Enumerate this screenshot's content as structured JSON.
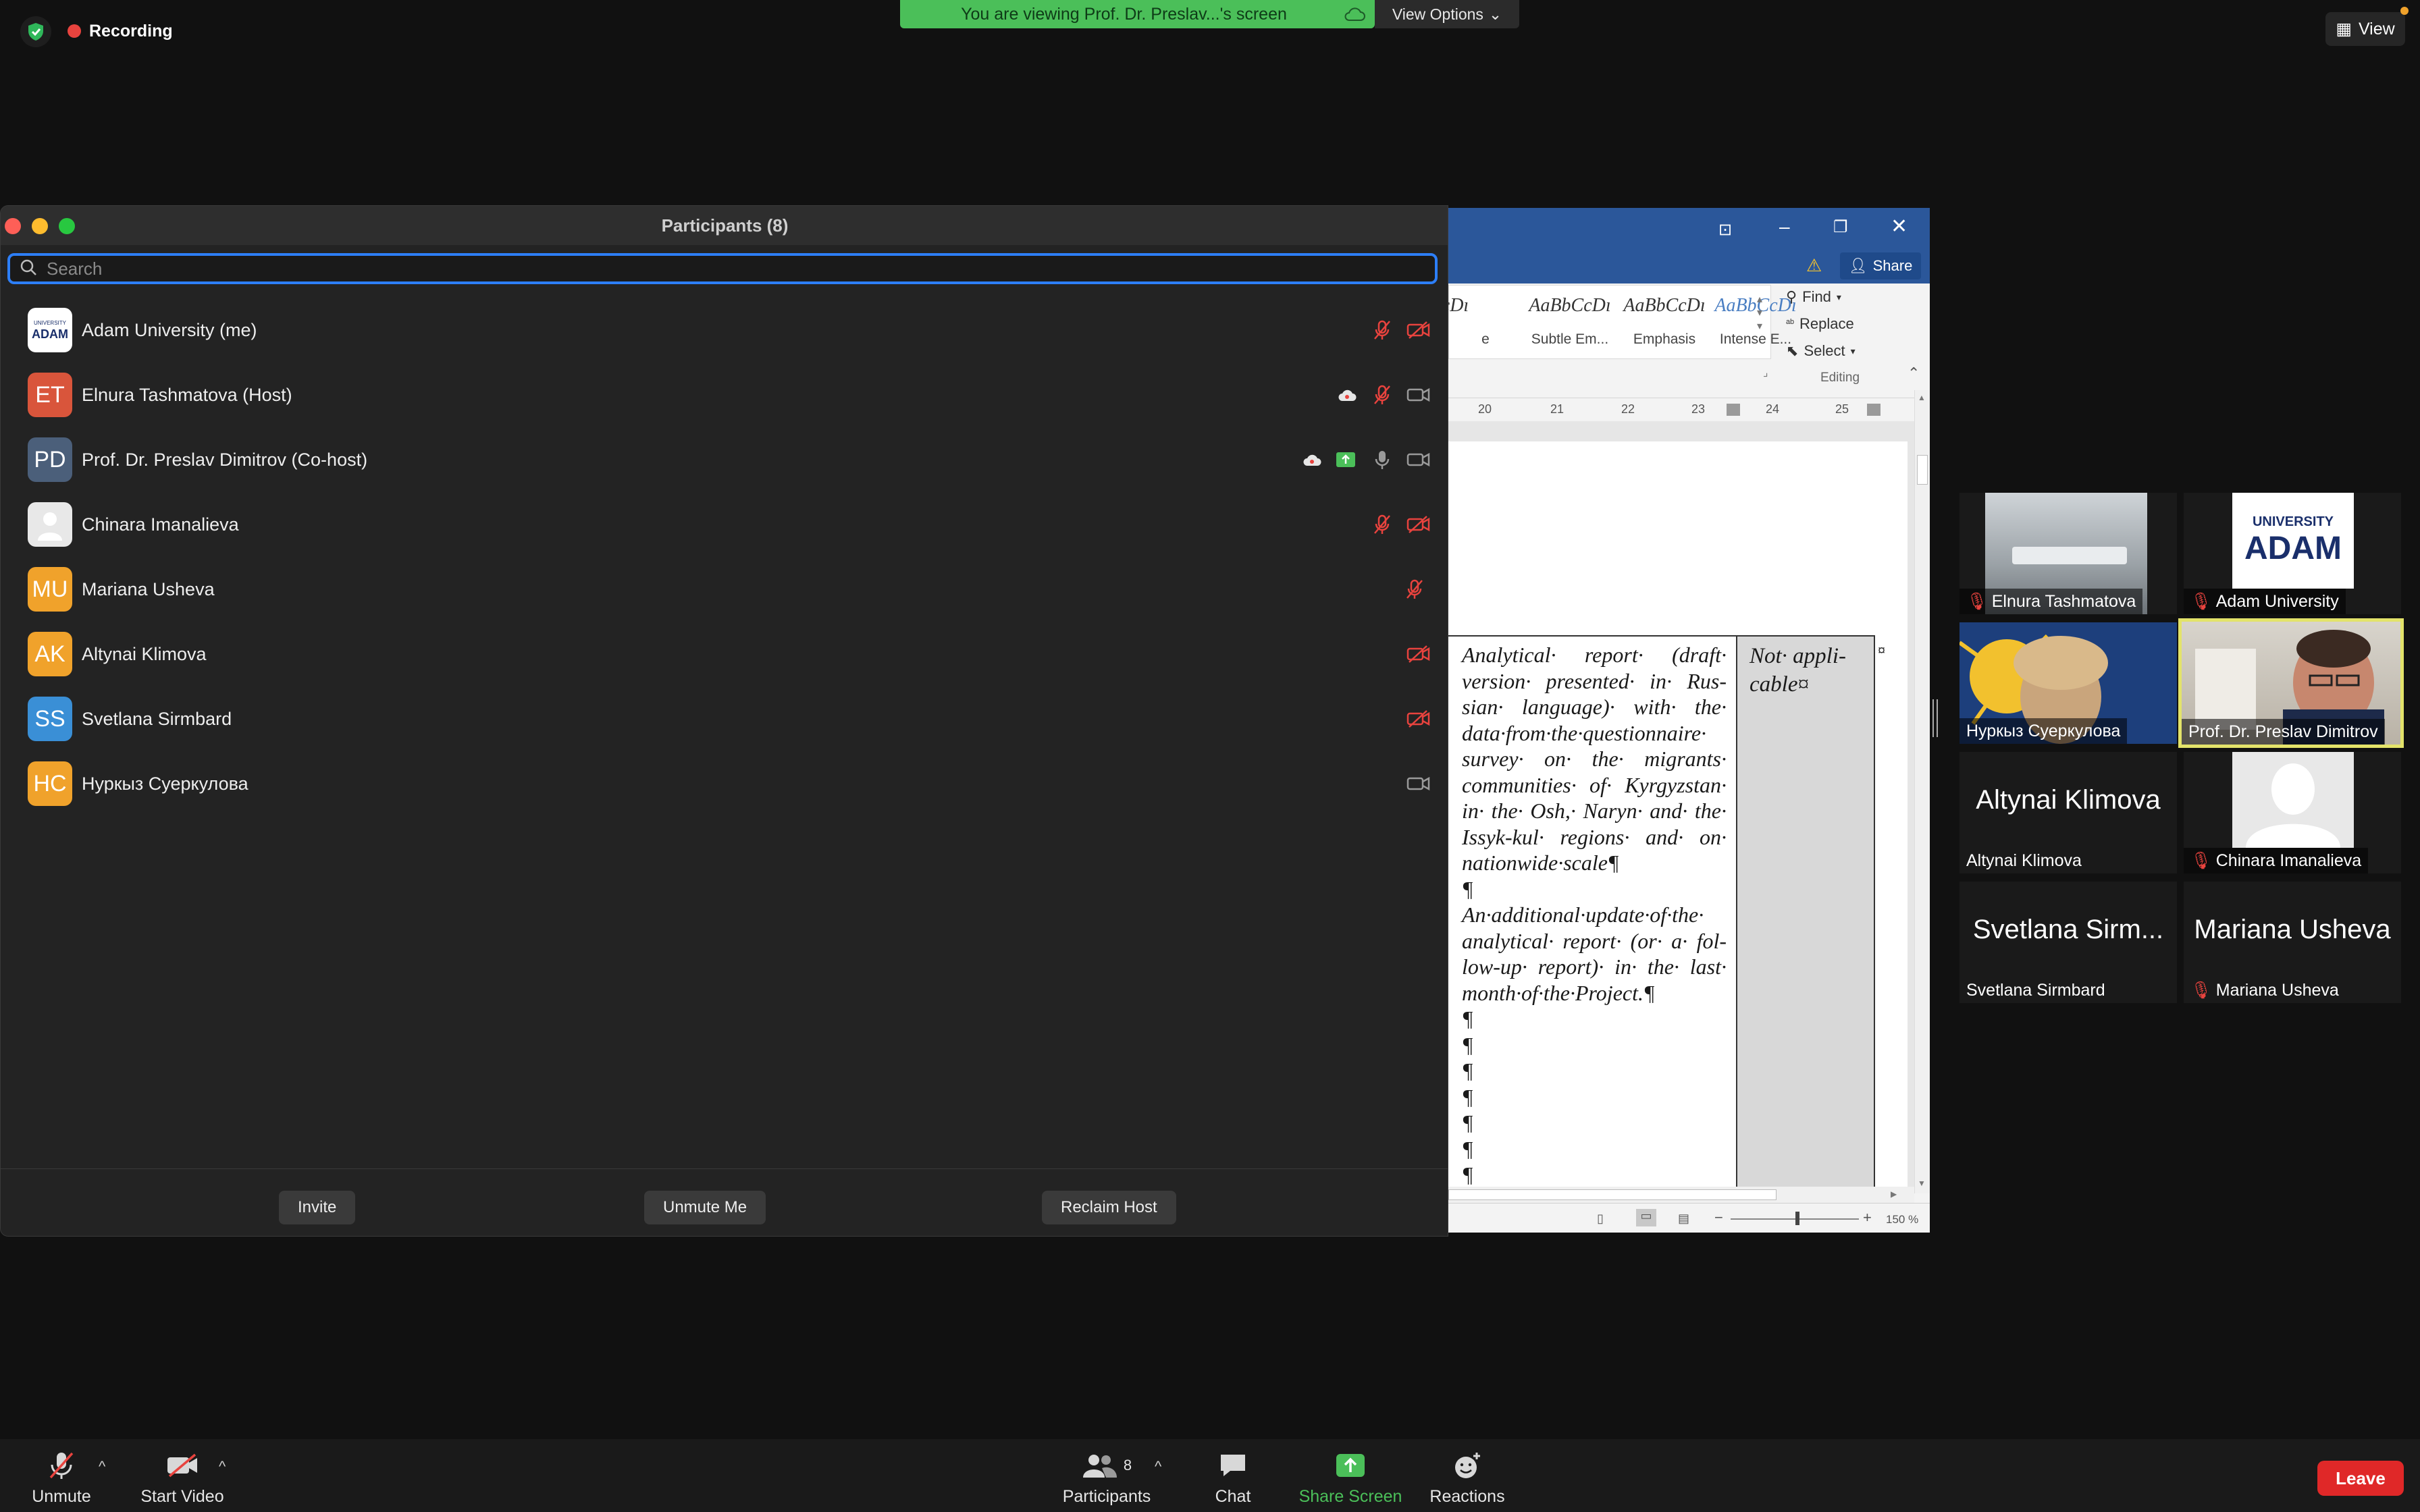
{
  "status": {
    "recording_label": "Recording"
  },
  "banner": {
    "text": "You are viewing Prof. Dr. Preslav...'s screen",
    "view_options_label": "View Options"
  },
  "view_button": {
    "label": "View"
  },
  "word": {
    "share_label": "Share",
    "styles": [
      "cDı",
      "AaBbCcDı",
      "AaBbCcDı",
      "AaBbCcDı"
    ],
    "style_names": [
      "e",
      "Subtle Em...",
      "Emphasis",
      "Intense E..."
    ],
    "find_label": "Find",
    "replace_label": "Replace",
    "select_label": "Select",
    "editing_label": "Editing",
    "ruler": [
      "20",
      "21",
      "22",
      "23",
      "24",
      "25"
    ],
    "doc_text_1": "Analytical· report· (draft· version· presented· in· Rus­sian· language)· with· the· data·from·the·questionnaire· survey· on· the· migrants· communities· of· Kyrgyzstan· in· the· Osh,· Naryn· and· the· Issyk-kul· regions· and· on· nationwide·scale¶",
    "doc_pilcrow": "¶",
    "doc_text_2": "An·additional·update·of·the· analytical· report· (or· a· fol­low-up· report)· in· the· last· month·of·the·Project.¶",
    "doc_trailing": "¶\n¶\n¶\n¶\n¶\n¶\n¶\n¶",
    "doc_col2_text": "Not· appli­cable¤",
    "zoom_level": "150 %"
  },
  "participants_panel": {
    "title": "Participants (8)",
    "search_placeholder": "Search",
    "participants": [
      {
        "name": "Adam University (me)",
        "initials": "",
        "avatar_color": "#ffffff",
        "mic": "muted",
        "video": "off"
      },
      {
        "name": "Elnura Tashmatova (Host)",
        "initials": "ET",
        "avatar_color": "#d9553b",
        "mic": "muted",
        "video": "on"
      },
      {
        "name": "Prof. Dr. Preslav Dimitrov (Co-host)",
        "initials": "PD",
        "avatar_color": "#4b5f7a",
        "mic": "on",
        "video": "on"
      },
      {
        "name": "Chinara Imanalieva",
        "initials": "",
        "avatar_color": "#e8e8e8",
        "mic": "muted",
        "video": "off"
      },
      {
        "name": "Mariana Usheva",
        "initials": "MU",
        "avatar_color": "#f0a22b",
        "mic": "muted",
        "video": "none"
      },
      {
        "name": "Altynai Klimova",
        "initials": "AK",
        "avatar_color": "#f0a22b",
        "mic": "none",
        "video": "off"
      },
      {
        "name": "Svetlana Sirmbard",
        "initials": "SS",
        "avatar_color": "#3a8fd6",
        "mic": "none",
        "video": "off"
      },
      {
        "name": "Нуркыз Суеркулова",
        "initials": "НС",
        "avatar_color": "#f0a22b",
        "mic": "none",
        "video": "on"
      }
    ],
    "invite_label": "Invite",
    "unmute_me_label": "Unmute Me",
    "reclaim_host_label": "Reclaim Host"
  },
  "gallery": [
    {
      "name": "Elnura Tashmatova",
      "big": "",
      "muted": true
    },
    {
      "name": "Adam University",
      "big": "",
      "muted": true
    },
    {
      "name": "Нуркыз Суеркулова",
      "big": "",
      "muted": false
    },
    {
      "name": "Prof. Dr. Preslav Dimitrov",
      "big": "",
      "muted": false
    },
    {
      "name": "Altynai Klimova",
      "big": "Altynai Klimova",
      "muted": false
    },
    {
      "name": "Chinara Imanalieva",
      "big": "",
      "muted": true
    },
    {
      "name": "Svetlana Sirmbard",
      "big": "Svetlana Sirm...",
      "muted": false
    },
    {
      "name": "Mariana Usheva",
      "big": "Mariana Usheva",
      "muted": true
    }
  ],
  "gallery_logo": {
    "top": "UNIVERSITY",
    "bottom": "ADAM"
  },
  "toolbar": {
    "unmute_label": "Unmute",
    "start_video_label": "Start Video",
    "participants_label": "Participants",
    "participants_count": "8",
    "chat_label": "Chat",
    "share_screen_label": "Share Screen",
    "reactions_label": "Reactions",
    "leave_label": "Leave"
  },
  "colors": {
    "accent": "#2d7ff9",
    "banner_green": "#4bbf59",
    "leave_red": "#e02828",
    "muted_red": "#e8433e",
    "speaker_highlight": "#e3e36a"
  }
}
